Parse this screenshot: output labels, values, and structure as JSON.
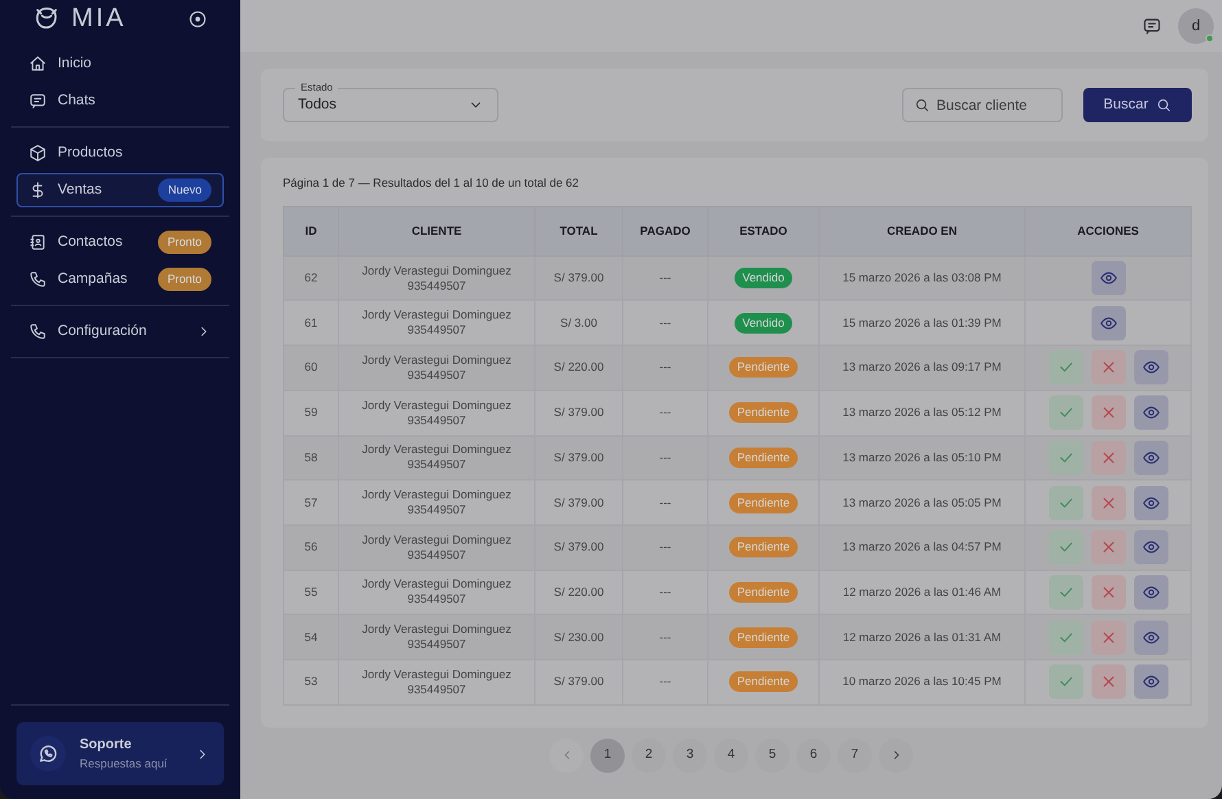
{
  "sidebar": {
    "brand": "MIA",
    "groups": [
      [
        {
          "label": "Inicio",
          "selected": false
        },
        {
          "label": "Chats",
          "selected": false
        }
      ],
      [
        {
          "label": "Productos",
          "selected": false
        },
        {
          "label": "Ventas",
          "selected": true,
          "badge": {
            "text": "Nuevo",
            "color": "#1d3f9e"
          }
        }
      ],
      [
        {
          "label": "Contactos",
          "selected": false,
          "badge": {
            "text": "Pronto",
            "color": "#b07a35"
          }
        },
        {
          "label": "Campañas",
          "selected": false,
          "badge": {
            "text": "Pronto",
            "color": "#b07a35"
          }
        }
      ],
      [
        {
          "label": "Configuración",
          "selected": false,
          "expanded": false
        }
      ]
    ],
    "support": {
      "title": "Soporte",
      "subtitle": "Respuestas aquí"
    }
  },
  "topbar": {
    "avatar": "d",
    "online": true
  },
  "filters": {
    "estado": {
      "label": "Estado",
      "value": "Todos"
    },
    "search": {
      "placeholder": "Buscar cliente"
    },
    "button": "Buscar"
  },
  "summary": "Página 1 de 7 — Resultados del 1 al 10 de un total de 62",
  "table": {
    "columns": [
      "ID",
      "CLIENTE",
      "TOTAL",
      "PAGADO",
      "ESTADO",
      "CREADO EN",
      "ACCIONES"
    ],
    "rows": [
      {
        "id": "62",
        "client": "Jordy Verastegui Dominguez",
        "phone": "935449507",
        "total": "S/ 379.00",
        "paid": "---",
        "status": {
          "text": "Vendido",
          "color": "#1f8f4e"
        },
        "created": "15 marzo 2026 a las 03:08 PM",
        "actions": [
          {
            "kind": "view"
          }
        ]
      },
      {
        "id": "61",
        "client": "Jordy Verastegui Dominguez",
        "phone": "935449507",
        "total": "S/ 3.00",
        "paid": "---",
        "status": {
          "text": "Vendido",
          "color": "#1f8f4e"
        },
        "created": "15 marzo 2026 a las 01:39 PM",
        "actions": [
          {
            "kind": "view"
          }
        ]
      },
      {
        "id": "60",
        "client": "Jordy Verastegui Dominguez",
        "phone": "935449507",
        "total": "S/ 220.00",
        "paid": "---",
        "status": {
          "text": "Pendiente",
          "color": "#c67f34"
        },
        "created": "13 marzo 2026 a las 09:17 PM",
        "actions": [
          {
            "kind": "approve"
          },
          {
            "kind": "reject"
          },
          {
            "kind": "view"
          }
        ]
      },
      {
        "id": "59",
        "client": "Jordy Verastegui Dominguez",
        "phone": "935449507",
        "total": "S/ 379.00",
        "paid": "---",
        "status": {
          "text": "Pendiente",
          "color": "#c67f34"
        },
        "created": "13 marzo 2026 a las 05:12 PM",
        "actions": [
          {
            "kind": "approve"
          },
          {
            "kind": "reject"
          },
          {
            "kind": "view"
          }
        ]
      },
      {
        "id": "58",
        "client": "Jordy Verastegui Dominguez",
        "phone": "935449507",
        "total": "S/ 379.00",
        "paid": "---",
        "status": {
          "text": "Pendiente",
          "color": "#c67f34"
        },
        "created": "13 marzo 2026 a las 05:10 PM",
        "actions": [
          {
            "kind": "approve"
          },
          {
            "kind": "reject"
          },
          {
            "kind": "view"
          }
        ]
      },
      {
        "id": "57",
        "client": "Jordy Verastegui Dominguez",
        "phone": "935449507",
        "total": "S/ 379.00",
        "paid": "---",
        "status": {
          "text": "Pendiente",
          "color": "#c67f34"
        },
        "created": "13 marzo 2026 a las 05:05 PM",
        "actions": [
          {
            "kind": "approve"
          },
          {
            "kind": "reject"
          },
          {
            "kind": "view"
          }
        ]
      },
      {
        "id": "56",
        "client": "Jordy Verastegui Dominguez",
        "phone": "935449507",
        "total": "S/ 379.00",
        "paid": "---",
        "status": {
          "text": "Pendiente",
          "color": "#c67f34"
        },
        "created": "13 marzo 2026 a las 04:57 PM",
        "actions": [
          {
            "kind": "approve"
          },
          {
            "kind": "reject"
          },
          {
            "kind": "view"
          }
        ]
      },
      {
        "id": "55",
        "client": "Jordy Verastegui Dominguez",
        "phone": "935449507",
        "total": "S/ 220.00",
        "paid": "---",
        "status": {
          "text": "Pendiente",
          "color": "#c67f34"
        },
        "created": "12 marzo 2026 a las 01:46 AM",
        "actions": [
          {
            "kind": "approve"
          },
          {
            "kind": "reject"
          },
          {
            "kind": "view"
          }
        ]
      },
      {
        "id": "54",
        "client": "Jordy Verastegui Dominguez",
        "phone": "935449507",
        "total": "S/ 230.00",
        "paid": "---",
        "status": {
          "text": "Pendiente",
          "color": "#c67f34"
        },
        "created": "12 marzo 2026 a las 01:31 AM",
        "actions": [
          {
            "kind": "approve"
          },
          {
            "kind": "reject"
          },
          {
            "kind": "view"
          }
        ]
      },
      {
        "id": "53",
        "client": "Jordy Verastegui Dominguez",
        "phone": "935449507",
        "total": "S/ 379.00",
        "paid": "---",
        "status": {
          "text": "Pendiente",
          "color": "#c67f34"
        },
        "created": "10 marzo 2026 a las 10:45 PM",
        "actions": [
          {
            "kind": "approve"
          },
          {
            "kind": "reject"
          },
          {
            "kind": "view"
          }
        ]
      }
    ]
  },
  "pagination": {
    "pages": [
      {
        "label": "1",
        "selected": true
      },
      {
        "label": "2",
        "selected": false
      },
      {
        "label": "3",
        "selected": false
      },
      {
        "label": "4",
        "selected": false
      },
      {
        "label": "5",
        "selected": false
      },
      {
        "label": "6",
        "selected": false
      },
      {
        "label": "7",
        "selected": false
      }
    ]
  }
}
